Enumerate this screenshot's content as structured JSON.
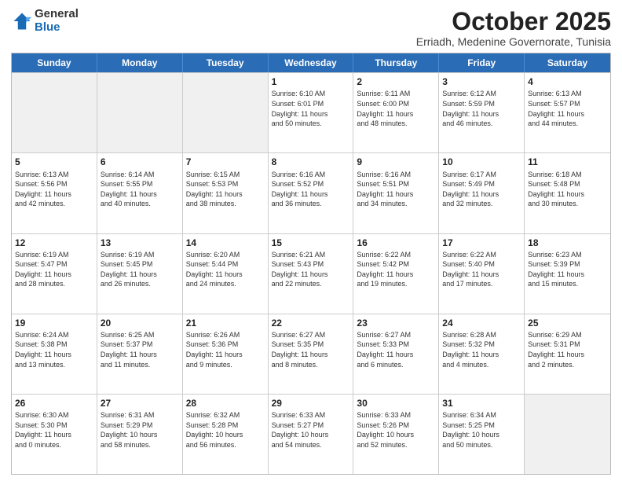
{
  "header": {
    "logo_general": "General",
    "logo_blue": "Blue",
    "title": "October 2025",
    "location": "Erriadh, Medenine Governorate, Tunisia"
  },
  "days_of_week": [
    "Sunday",
    "Monday",
    "Tuesday",
    "Wednesday",
    "Thursday",
    "Friday",
    "Saturday"
  ],
  "weeks": [
    [
      {
        "day": "",
        "info": "",
        "shaded": true
      },
      {
        "day": "",
        "info": "",
        "shaded": true
      },
      {
        "day": "",
        "info": "",
        "shaded": true
      },
      {
        "day": "1",
        "info": "Sunrise: 6:10 AM\nSunset: 6:01 PM\nDaylight: 11 hours\nand 50 minutes."
      },
      {
        "day": "2",
        "info": "Sunrise: 6:11 AM\nSunset: 6:00 PM\nDaylight: 11 hours\nand 48 minutes."
      },
      {
        "day": "3",
        "info": "Sunrise: 6:12 AM\nSunset: 5:59 PM\nDaylight: 11 hours\nand 46 minutes."
      },
      {
        "day": "4",
        "info": "Sunrise: 6:13 AM\nSunset: 5:57 PM\nDaylight: 11 hours\nand 44 minutes."
      }
    ],
    [
      {
        "day": "5",
        "info": "Sunrise: 6:13 AM\nSunset: 5:56 PM\nDaylight: 11 hours\nand 42 minutes."
      },
      {
        "day": "6",
        "info": "Sunrise: 6:14 AM\nSunset: 5:55 PM\nDaylight: 11 hours\nand 40 minutes."
      },
      {
        "day": "7",
        "info": "Sunrise: 6:15 AM\nSunset: 5:53 PM\nDaylight: 11 hours\nand 38 minutes."
      },
      {
        "day": "8",
        "info": "Sunrise: 6:16 AM\nSunset: 5:52 PM\nDaylight: 11 hours\nand 36 minutes."
      },
      {
        "day": "9",
        "info": "Sunrise: 6:16 AM\nSunset: 5:51 PM\nDaylight: 11 hours\nand 34 minutes."
      },
      {
        "day": "10",
        "info": "Sunrise: 6:17 AM\nSunset: 5:49 PM\nDaylight: 11 hours\nand 32 minutes."
      },
      {
        "day": "11",
        "info": "Sunrise: 6:18 AM\nSunset: 5:48 PM\nDaylight: 11 hours\nand 30 minutes."
      }
    ],
    [
      {
        "day": "12",
        "info": "Sunrise: 6:19 AM\nSunset: 5:47 PM\nDaylight: 11 hours\nand 28 minutes."
      },
      {
        "day": "13",
        "info": "Sunrise: 6:19 AM\nSunset: 5:45 PM\nDaylight: 11 hours\nand 26 minutes."
      },
      {
        "day": "14",
        "info": "Sunrise: 6:20 AM\nSunset: 5:44 PM\nDaylight: 11 hours\nand 24 minutes."
      },
      {
        "day": "15",
        "info": "Sunrise: 6:21 AM\nSunset: 5:43 PM\nDaylight: 11 hours\nand 22 minutes."
      },
      {
        "day": "16",
        "info": "Sunrise: 6:22 AM\nSunset: 5:42 PM\nDaylight: 11 hours\nand 19 minutes."
      },
      {
        "day": "17",
        "info": "Sunrise: 6:22 AM\nSunset: 5:40 PM\nDaylight: 11 hours\nand 17 minutes."
      },
      {
        "day": "18",
        "info": "Sunrise: 6:23 AM\nSunset: 5:39 PM\nDaylight: 11 hours\nand 15 minutes."
      }
    ],
    [
      {
        "day": "19",
        "info": "Sunrise: 6:24 AM\nSunset: 5:38 PM\nDaylight: 11 hours\nand 13 minutes."
      },
      {
        "day": "20",
        "info": "Sunrise: 6:25 AM\nSunset: 5:37 PM\nDaylight: 11 hours\nand 11 minutes."
      },
      {
        "day": "21",
        "info": "Sunrise: 6:26 AM\nSunset: 5:36 PM\nDaylight: 11 hours\nand 9 minutes."
      },
      {
        "day": "22",
        "info": "Sunrise: 6:27 AM\nSunset: 5:35 PM\nDaylight: 11 hours\nand 8 minutes."
      },
      {
        "day": "23",
        "info": "Sunrise: 6:27 AM\nSunset: 5:33 PM\nDaylight: 11 hours\nand 6 minutes."
      },
      {
        "day": "24",
        "info": "Sunrise: 6:28 AM\nSunset: 5:32 PM\nDaylight: 11 hours\nand 4 minutes."
      },
      {
        "day": "25",
        "info": "Sunrise: 6:29 AM\nSunset: 5:31 PM\nDaylight: 11 hours\nand 2 minutes."
      }
    ],
    [
      {
        "day": "26",
        "info": "Sunrise: 6:30 AM\nSunset: 5:30 PM\nDaylight: 11 hours\nand 0 minutes."
      },
      {
        "day": "27",
        "info": "Sunrise: 6:31 AM\nSunset: 5:29 PM\nDaylight: 10 hours\nand 58 minutes."
      },
      {
        "day": "28",
        "info": "Sunrise: 6:32 AM\nSunset: 5:28 PM\nDaylight: 10 hours\nand 56 minutes."
      },
      {
        "day": "29",
        "info": "Sunrise: 6:33 AM\nSunset: 5:27 PM\nDaylight: 10 hours\nand 54 minutes."
      },
      {
        "day": "30",
        "info": "Sunrise: 6:33 AM\nSunset: 5:26 PM\nDaylight: 10 hours\nand 52 minutes."
      },
      {
        "day": "31",
        "info": "Sunrise: 6:34 AM\nSunset: 5:25 PM\nDaylight: 10 hours\nand 50 minutes."
      },
      {
        "day": "",
        "info": "",
        "shaded": true
      }
    ]
  ]
}
